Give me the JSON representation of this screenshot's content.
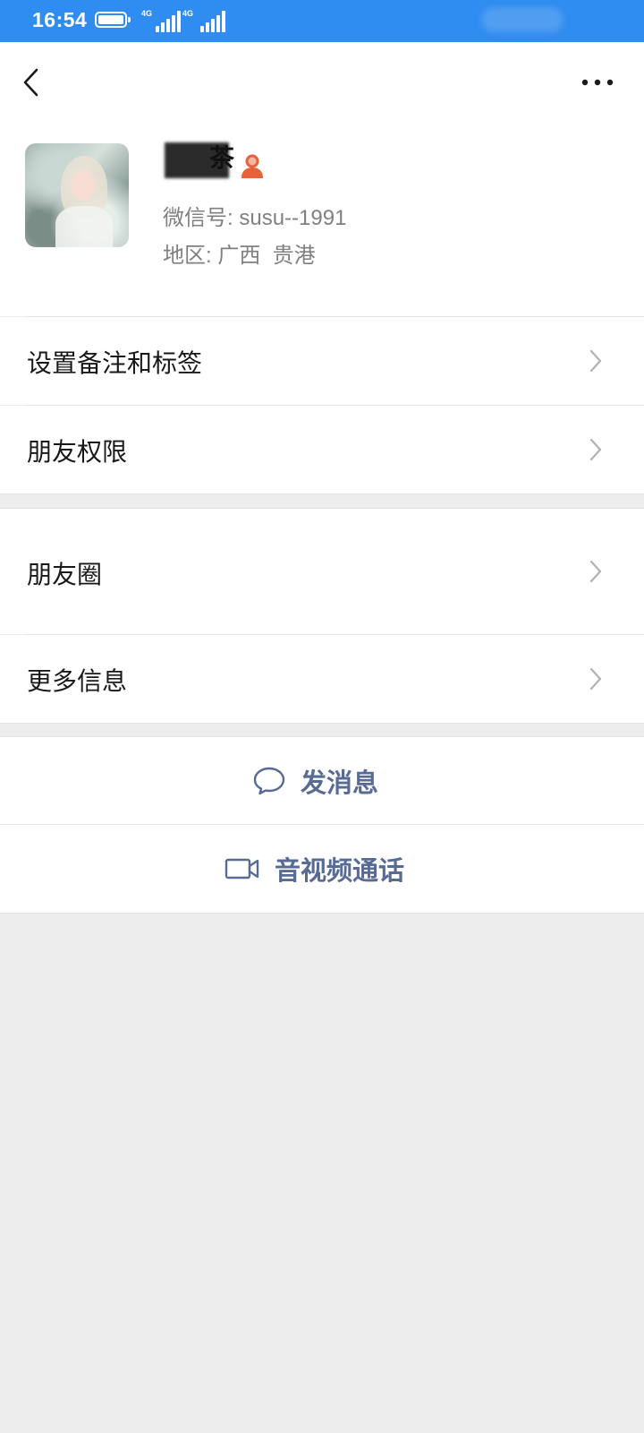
{
  "status_bar": {
    "time": "16:54",
    "network_1": "4G",
    "network_2": "4G"
  },
  "nav": {
    "back_icon": "chevron-left-icon",
    "more_icon": "more-dots-icon"
  },
  "profile": {
    "nickname": "茶",
    "gender_icon": "female-user-icon",
    "wechat_id_label": "微信号: ",
    "wechat_id": "susu--1991",
    "region_label": "地区: ",
    "region": "广西  贵港"
  },
  "menu": {
    "remark_tags": "设置备注和标签",
    "friend_permissions": "朋友权限",
    "moments": "朋友圈",
    "more_info": "更多信息"
  },
  "actions": {
    "send_message": "发消息",
    "av_call": "音视频通话"
  },
  "colors": {
    "status_bar": "#2f8cf0",
    "link": "#576b95",
    "background": "#ededed",
    "gender_icon": "#e8603c"
  }
}
